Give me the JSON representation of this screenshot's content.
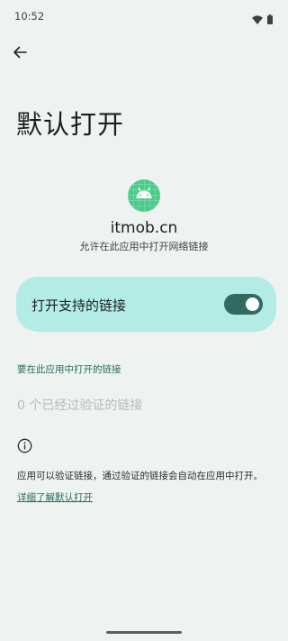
{
  "status_bar": {
    "time": "10:52",
    "icons": [
      "wifi-icon",
      "battery-icon"
    ]
  },
  "header": {
    "back_icon": "arrow-back-icon",
    "title": "默认打开"
  },
  "app": {
    "icon": "android-icon",
    "name": "itmob.cn",
    "subtitle": "允许在此应用中打开网络链接"
  },
  "open_supported_links": {
    "label": "打开支持的链接",
    "enabled": true
  },
  "links_section": {
    "header": "要在此应用中打开的链接",
    "empty_text": "0 个已经过验证的链接"
  },
  "info": {
    "icon": "info-icon",
    "text": "应用可以验证链接，通过验证的链接会自动在应用中打开。",
    "learn_more": "详细了解默认打开"
  },
  "colors": {
    "background": "#eef2f0",
    "card": "#b3ece4",
    "accent": "#2f6b63",
    "link": "#2b6b62"
  }
}
